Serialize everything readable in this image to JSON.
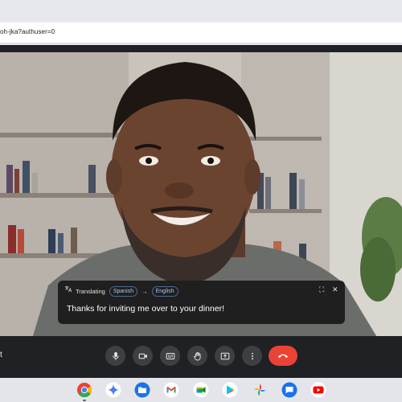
{
  "browser": {
    "url_fragment": "oh-jka?authuser=0"
  },
  "caption": {
    "status": "Translating",
    "source_language": "Spanish",
    "arrow": "→",
    "target_language": "English",
    "text": "Thanks for inviting me over to your dinner!",
    "expand_glyph": "⛶",
    "close_glyph": "✕"
  },
  "controls": {
    "meeting_code_partial": "t",
    "buttons": [
      "microphone-icon",
      "camera-icon",
      "captions-icon",
      "raise-hand-icon",
      "present-icon",
      "more-options-icon"
    ],
    "hangup": "hangup-icon"
  },
  "shelf": {
    "apps": [
      "chrome-icon",
      "gemini-icon",
      "files-icon",
      "gmail-icon",
      "meet-icon",
      "play-store-icon",
      "photos-icon",
      "messages-icon",
      "youtube-icon"
    ]
  },
  "colors": {
    "meet_background": "#202124",
    "button": "#3c4043",
    "hangup": "#ea4335",
    "caption_bg": "#1f1f1f",
    "chip": "#a8c7fa"
  }
}
